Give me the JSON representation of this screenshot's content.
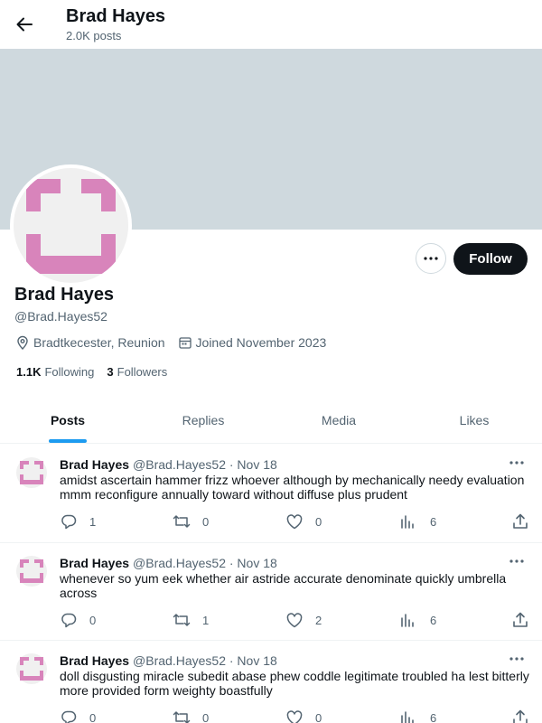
{
  "header": {
    "title": "Brad Hayes",
    "post_count": "2.0K posts"
  },
  "profile": {
    "name": "Brad Hayes",
    "handle": "@Brad.Hayes52",
    "location": "Bradtkecester, Reunion",
    "joined": "Joined November 2023",
    "following_count": "1.1K",
    "following_label": "Following",
    "followers_count": "3",
    "followers_label": "Followers",
    "follow_label": "Follow",
    "avatar_color": "#d884bb",
    "banner_color": "#cfd9de"
  },
  "tabs": [
    {
      "label": "Posts",
      "active": true
    },
    {
      "label": "Replies",
      "active": false
    },
    {
      "label": "Media",
      "active": false
    },
    {
      "label": "Likes",
      "active": false
    }
  ],
  "posts": [
    {
      "name": "Brad Hayes",
      "handle": "@Brad.Hayes52",
      "date": "· Nov 18",
      "text": "amidst ascertain hammer frizz whoever although by mechanically needy evaluation mmm reconfigure annually toward without diffuse plus prudent",
      "replies": "1",
      "reposts": "0",
      "likes": "0",
      "views": "6"
    },
    {
      "name": "Brad Hayes",
      "handle": "@Brad.Hayes52",
      "date": "· Nov 18",
      "text": "whenever so yum eek whether air astride accurate denominate quickly umbrella across",
      "replies": "0",
      "reposts": "1",
      "likes": "2",
      "views": "6"
    },
    {
      "name": "Brad Hayes",
      "handle": "@Brad.Hayes52",
      "date": "· Nov 18",
      "text": "doll disgusting miracle subedit abase phew coddle legitimate troubled ha lest bitterly more provided form weighty boastfully",
      "replies": "0",
      "reposts": "0",
      "likes": "0",
      "views": "6"
    }
  ],
  "colors": {
    "accent": "#1d9bf0",
    "text": "#0f1419",
    "muted": "#536471"
  }
}
